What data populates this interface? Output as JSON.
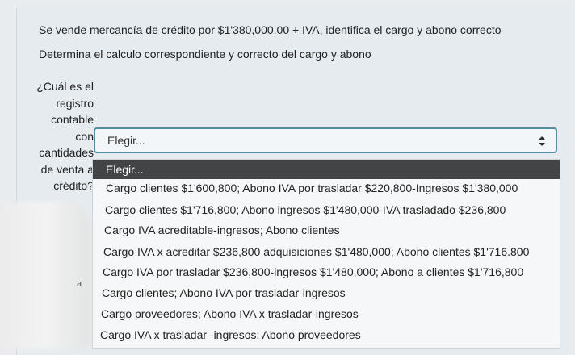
{
  "question": {
    "line1": "Se vende mercancía de crédito por $1'380,000.00 + IVA, identifica el cargo y abono correcto",
    "line2": "Determina el calculo correspondiente y correcto del cargo y abono",
    "side_label": "¿Cuál es el\nregistro\ncontable\ncon\ncantidades\nde venta a\ncrédito?"
  },
  "select": {
    "current_value": "Elegir...",
    "caret_icon": "updown-arrow-icon",
    "options": [
      "Elegir...",
      "Cargo clientes $1'600,800; Abono IVA por trasladar $220,800-Ingresos $1'380,000",
      "Cargo clientes $1'716,800; Abono ingresos $1'480,000-IVA trasladado $236,800",
      "Cargo IVA acreditable-ingresos; Abono clientes",
      "Cargo IVA x acreditar $236,800 adquisiciones $1'480,000; Abono clientes $1'716.800",
      "Cargo IVA por trasladar $236,800-ingresos $1'480,000; Abono a clientes $1'716,800",
      "Cargo clientes; Abono IVA por trasladar-ingresos",
      "Cargo proveedores; Abono IVA x trasladar-ingresos",
      "Cargo IVA x trasladar -ingresos; Abono proveedores"
    ],
    "selected_index": 0
  },
  "overlay": {
    "mark": "a"
  },
  "colors": {
    "background": "#e9ecef",
    "select_border": "#4f8fa0",
    "highlight": "#434446"
  }
}
